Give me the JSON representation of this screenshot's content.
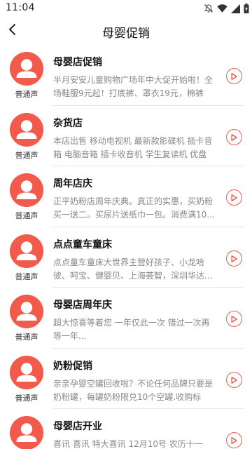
{
  "status_bar": {
    "time": "11:04",
    "icons": [
      "notifications-off-icon",
      "wifi-icon",
      "signal-icon",
      "battery-charging-icon"
    ]
  },
  "header": {
    "back_icon": "back-arrow-icon",
    "title": "母婴促销"
  },
  "colors": {
    "accent": "#f25a4c",
    "description": "#888888",
    "divider": "#e6e6e6"
  },
  "items": [
    {
      "title": "母婴店促销",
      "voice": "普通声",
      "desc": "半月安安儿童购物广场年中大促开始啦！全场鞋服9元起！打底裤、罩衣19元，棉裤2..."
    },
    {
      "title": "杂货店",
      "voice": "普通声",
      "desc": "本店出售 移动电视机 最新款影碟机 插卡音箱 电脑音箱 插卡收音机 学生复读机 优盘 ..."
    },
    {
      "title": "周年店庆",
      "voice": "普通声",
      "desc": "正平奶粉店周年庆典。真正的实惠，买奶粉买一送二。买尿片送纸巾一包。消费满10..."
    },
    {
      "title": "点点童车童床",
      "voice": "普通声",
      "desc": "点点童车童床大世界主营好孩子、小龙哈彼、呵宝、健婴贝、上海荟智，深圳华达..."
    },
    {
      "title": "母婴店周年庆",
      "voice": "普通声",
      "desc": "超大惊喜等着您 一年仅此一次 错过一次再等一年..."
    },
    {
      "title": "奶粉促销",
      "voice": "普通声",
      "desc": "亲亲孕婴空罐回收啦？不论任何品牌只要是奶粉罐，每罐奶粉限兑10个空罐.收购标准..."
    },
    {
      "title": "母婴店开业",
      "voice": "普通声",
      "desc": "喜讯 喜讯 特大喜讯 12月10号 农历十一月..."
    }
  ]
}
